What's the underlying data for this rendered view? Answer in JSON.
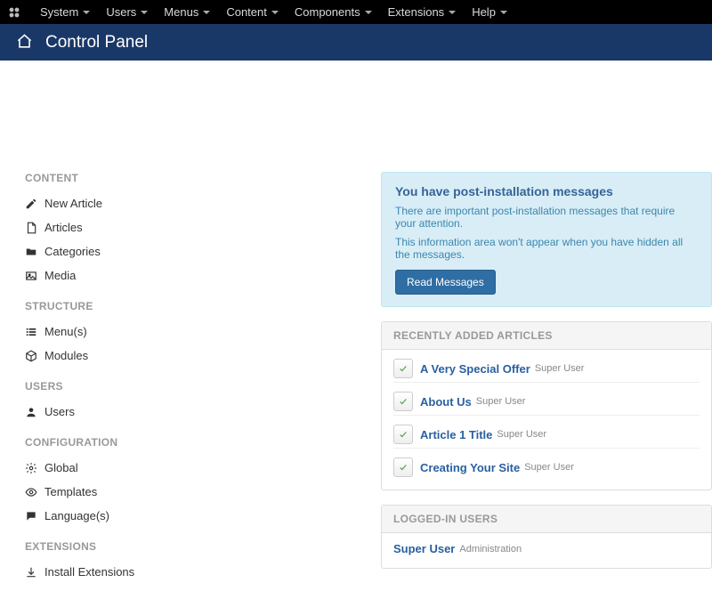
{
  "topnav": {
    "items": [
      {
        "label": "System"
      },
      {
        "label": "Users"
      },
      {
        "label": "Menus"
      },
      {
        "label": "Content"
      },
      {
        "label": "Components"
      },
      {
        "label": "Extensions"
      },
      {
        "label": "Help"
      }
    ]
  },
  "subheader": {
    "title": "Control Panel"
  },
  "sidebar": {
    "sections": [
      {
        "heading": "CONTENT",
        "items": [
          {
            "icon": "pencil",
            "label": "New Article"
          },
          {
            "icon": "file",
            "label": "Articles"
          },
          {
            "icon": "folder",
            "label": "Categories"
          },
          {
            "icon": "image",
            "label": "Media"
          }
        ]
      },
      {
        "heading": "STRUCTURE",
        "items": [
          {
            "icon": "list",
            "label": "Menu(s)"
          },
          {
            "icon": "cube",
            "label": "Modules"
          }
        ]
      },
      {
        "heading": "USERS",
        "items": [
          {
            "icon": "user",
            "label": "Users"
          }
        ]
      },
      {
        "heading": "CONFIGURATION",
        "items": [
          {
            "icon": "cog",
            "label": "Global"
          },
          {
            "icon": "eye",
            "label": "Templates"
          },
          {
            "icon": "comment",
            "label": "Language(s)"
          }
        ]
      },
      {
        "heading": "EXTENSIONS",
        "items": [
          {
            "icon": "download",
            "label": "Install Extensions"
          }
        ]
      }
    ]
  },
  "info_panel": {
    "title": "You have post-installation messages",
    "line1": "There are important post-installation messages that require your attention.",
    "line2": "This information area won't appear when you have hidden all the messages.",
    "button": "Read Messages"
  },
  "recent_panel": {
    "heading": "RECENTLY ADDED ARTICLES",
    "rows": [
      {
        "title": "A Very Special Offer",
        "author": "Super User"
      },
      {
        "title": "About Us",
        "author": "Super User"
      },
      {
        "title": "Article 1 Title",
        "author": "Super User"
      },
      {
        "title": "Creating Your Site",
        "author": "Super User"
      }
    ]
  },
  "loggedin_panel": {
    "heading": "LOGGED-IN USERS",
    "rows": [
      {
        "name": "Super User",
        "meta": "Administration"
      }
    ]
  }
}
